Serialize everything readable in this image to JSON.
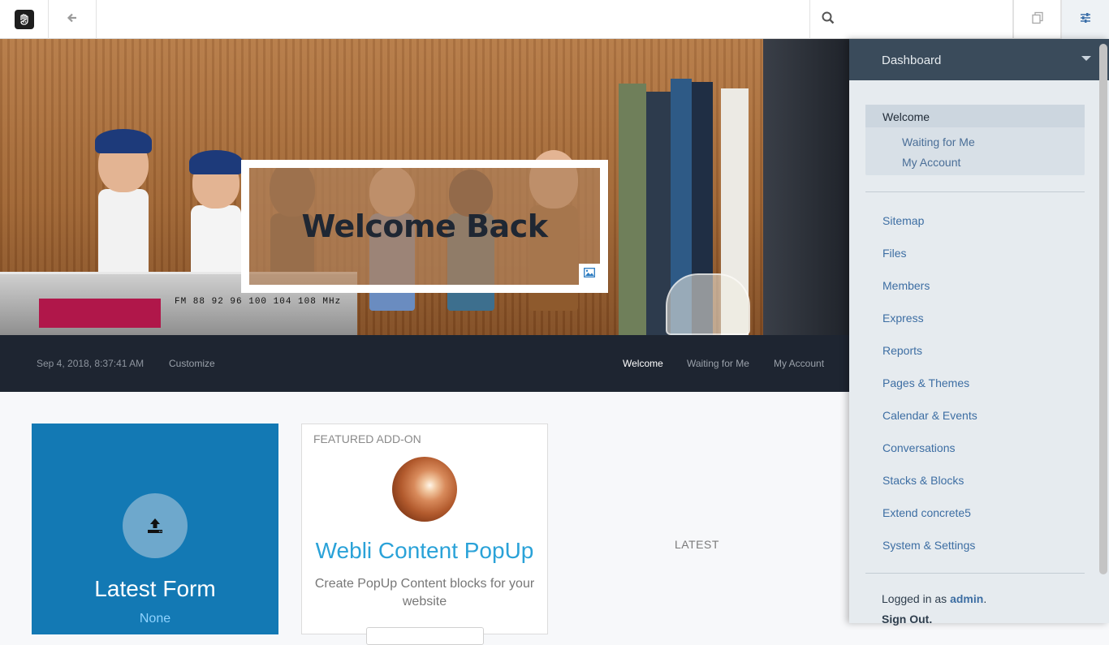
{
  "toolbar": {
    "logo_icon": "concrete5-hand-logo-icon",
    "back_icon": "arrow-left-icon",
    "search_icon": "search-icon",
    "search_value": "",
    "pages_icon": "pages-icon",
    "settings_icon": "sliders-icon"
  },
  "hero": {
    "title": "Welcome Back",
    "image_button_icon": "image-icon",
    "radio_band": "FM 88 92 96 100 104 108 MHz"
  },
  "navbar": {
    "timestamp": "Sep 4, 2018, 8:37:41 AM",
    "customize": "Customize",
    "links": [
      "Welcome",
      "Waiting for Me",
      "My Account"
    ],
    "active": "Welcome"
  },
  "tiles": {
    "form": {
      "icon": "upload-icon",
      "title": "Latest Form",
      "value": "None",
      "color": "#1379b4"
    },
    "addon": {
      "label": "FEATURED ADD-ON",
      "name": "Webli Content PopUp",
      "description": "Create PopUp Content blocks for your website"
    },
    "latest_label": "LATEST"
  },
  "panel": {
    "header": "Dashboard",
    "group": {
      "active": "Welcome",
      "items": [
        "Waiting for Me",
        "My Account"
      ]
    },
    "menu": [
      "Sitemap",
      "Files",
      "Members",
      "Express",
      "Reports",
      "Pages & Themes",
      "Calendar & Events",
      "Conversations",
      "Stacks & Blocks",
      "Extend concrete5",
      "System & Settings"
    ],
    "logged_in_prefix": "Logged in as",
    "user": "admin",
    "logged_in_suffix": ".",
    "signout": "Sign Out."
  }
}
